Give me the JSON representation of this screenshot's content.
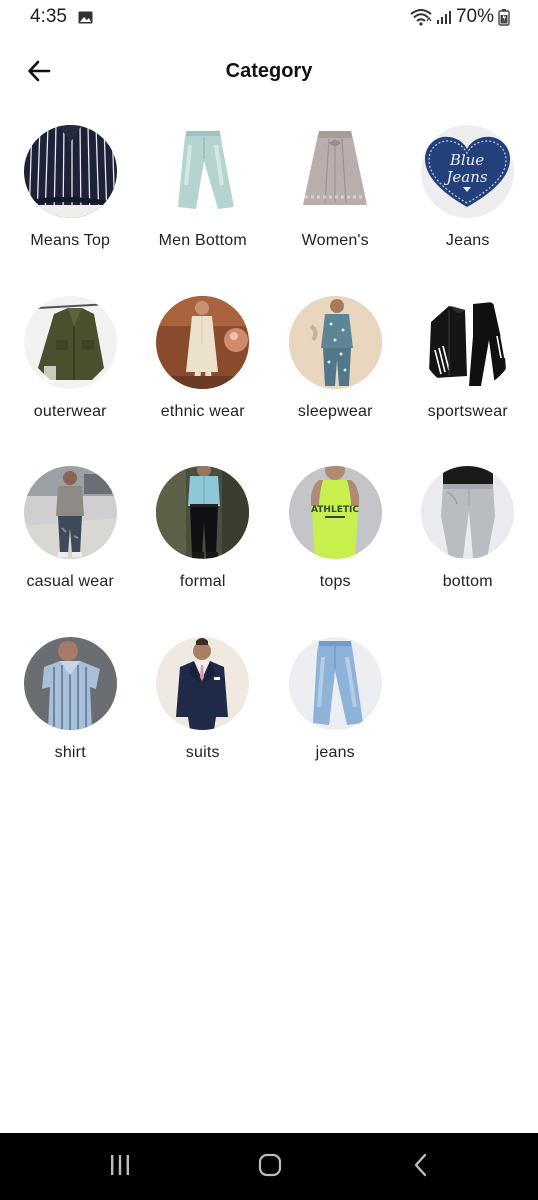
{
  "status_bar": {
    "time": "4:35",
    "battery": "70%",
    "icons": [
      "gallery-icon",
      "wifi-icon",
      "signal-icon",
      "battery-icon"
    ]
  },
  "header": {
    "title": "Category",
    "back_icon": "arrow-left-icon"
  },
  "categories": [
    {
      "label": "Means Top",
      "image": "striped-shirt"
    },
    {
      "label": "Men Bottom",
      "image": "light-jeans"
    },
    {
      "label": "Women's",
      "image": "skirt"
    },
    {
      "label": "Jeans",
      "image": "blue-jeans-heart-logo",
      "logo_text_1": "Blue",
      "logo_text_2": "Jeans"
    },
    {
      "label": "outerwear",
      "image": "olive-jacket"
    },
    {
      "label": "ethnic wear",
      "image": "kurta"
    },
    {
      "label": "sleepwear",
      "image": "pajama-set"
    },
    {
      "label": "sportswear",
      "image": "tracksuit"
    },
    {
      "label": "casual wear",
      "image": "casual-outfit"
    },
    {
      "label": "formal",
      "image": "formal-outfit"
    },
    {
      "label": "tops",
      "image": "tank-top",
      "logo_text_1": "ATHLETIC"
    },
    {
      "label": "bottom",
      "image": "grey-joggers"
    },
    {
      "label": "shirt",
      "image": "striped-short-sleeve-shirt"
    },
    {
      "label": "suits",
      "image": "navy-suit"
    },
    {
      "label": "jeans",
      "image": "light-blue-jeans"
    }
  ],
  "nav_bar": {
    "recents_icon": "recents-icon",
    "home_icon": "home-icon",
    "back_icon": "nav-back-icon"
  }
}
